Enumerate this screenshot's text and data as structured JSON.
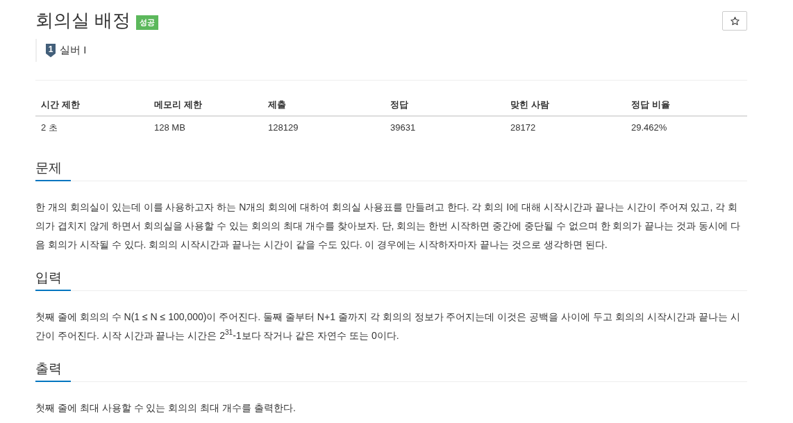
{
  "header": {
    "title": "회의실 배정",
    "result_badge": "성공",
    "star_button": {
      "starred": false
    },
    "tier": {
      "digit": "1",
      "label": "실버 I"
    }
  },
  "stats_table": {
    "columns": [
      "시간 제한",
      "메모리 제한",
      "제출",
      "정답",
      "맞힌 사람",
      "정답 비율"
    ],
    "rows": [
      [
        "2 초",
        "128 MB",
        "128129",
        "39631",
        "28172",
        "29.462%"
      ]
    ]
  },
  "sections": [
    {
      "title": "문제",
      "paragraphs": [
        "한 개의 회의실이 있는데 이를 사용하고자 하는 N개의 회의에 대하여 회의실 사용표를 만들려고 한다. 각 회의 I에 대해 시작시간과 끝나는 시간이 주어져 있고, 각 회의가 겹치지 않게 하면서 회의실을 사용할 수 있는 회의의 최대 개수를 찾아보자. 단, 회의는 한번 시작하면 중간에 중단될 수 없으며 한 회의가 끝나는 것과 동시에 다음 회의가 시작될 수 있다. 회의의 시작시간과 끝나는 시간이 같을 수도 있다. 이 경우에는 시작하자마자 끝나는 것으로 생각하면 된다."
      ]
    },
    {
      "title": "입력",
      "paragraphs": [
        "첫째 줄에 회의의 수 N(1 ≤ N ≤ 100,000)이 주어진다. 둘째 줄부터 N+1 줄까지 각 회의의 정보가 주어지는데 이것은 공백을 사이에 두고 회의의 시작시간과 끝나는 시간이 주어진다. 시작 시간과 끝나는 시간은 2$^{31}$-1보다 작거나 같은 자연수 또는 0이다."
      ]
    },
    {
      "title": "출력",
      "paragraphs": [
        "첫째 줄에 최대 사용할 수 있는 회의의 최대 개수를 출력한다."
      ]
    }
  ]
}
